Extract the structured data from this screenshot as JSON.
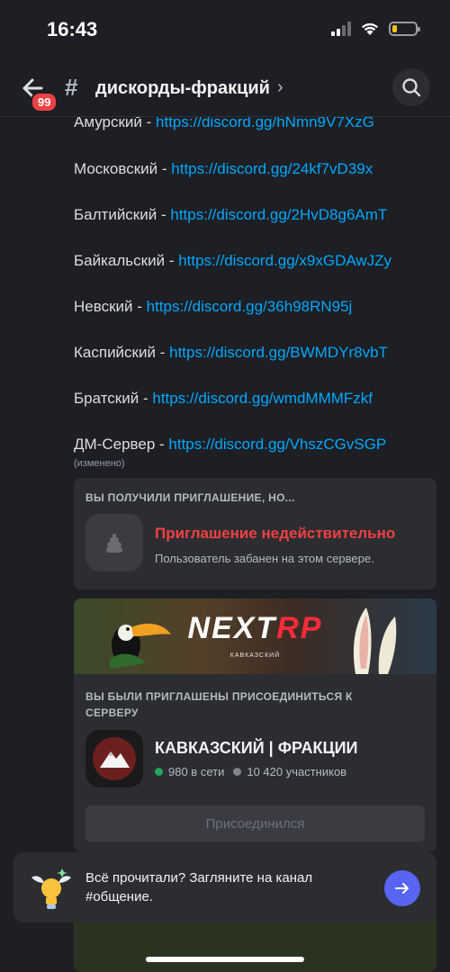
{
  "status": {
    "time": "16:43"
  },
  "header": {
    "badge": "99",
    "channel_name": "дискорды-фракций",
    "chevron": "›"
  },
  "messages": [
    {
      "name": "Амурский",
      "sep": " - ",
      "link": "https://discord.gg/hNmn9V7XzG"
    },
    {
      "name": "Московский",
      "sep": " - ",
      "link": "https://discord.gg/24kf7vD39x"
    },
    {
      "name": "Балтийский",
      "sep": " - ",
      "link": "https://discord.gg/2HvD8g6AmT"
    },
    {
      "name": "Байкальский",
      "sep": " - ",
      "link": "https://discord.gg/x9xGDAwJZy"
    },
    {
      "name": "Невский",
      "sep": " - ",
      "link": "https://discord.gg/36h98RN95j"
    },
    {
      "name": "Каспийский",
      "sep": " - ",
      "link": "https://discord.gg/BWMDYr8vbT"
    },
    {
      "name": "Братский",
      "sep": " - ",
      "link": "https://discord.gg/wmdMMMFzkf"
    },
    {
      "name": "ДМ-Сервер",
      "sep": " - ",
      "link": "https://discord.gg/VhszCGvSGP"
    }
  ],
  "edited_label": "(изменено)",
  "invalid_invite": {
    "heading": "ВЫ ПОЛУЧИЛИ ПРИГЛАШЕНИЕ, НО...",
    "title": "Приглашение недействительно",
    "description": "Пользователь забанен на этом сервере."
  },
  "valid_invite": {
    "banner_logo_main": "NEXT",
    "banner_logo_accent": "RP",
    "banner_sub": "КАВКАЗСКИЙ",
    "heading": "ВЫ БЫЛИ ПРИГЛАШЕНЫ ПРИСОЕДИНИТЬСЯ К СЕРВЕРУ",
    "server_name": "КАВКАЗСКИЙ | ФРАКЦИИ",
    "online": "980 в сети",
    "members": "10 420 участников",
    "button_label": "Присоединился"
  },
  "prompt": {
    "text": "Всё прочитали? Загляните на канал #общение."
  },
  "colors": {
    "link": "#00a8fc",
    "error": "#f23f43",
    "online": "#23a55a",
    "accent": "#5865f2",
    "badge": "#ed4245"
  }
}
